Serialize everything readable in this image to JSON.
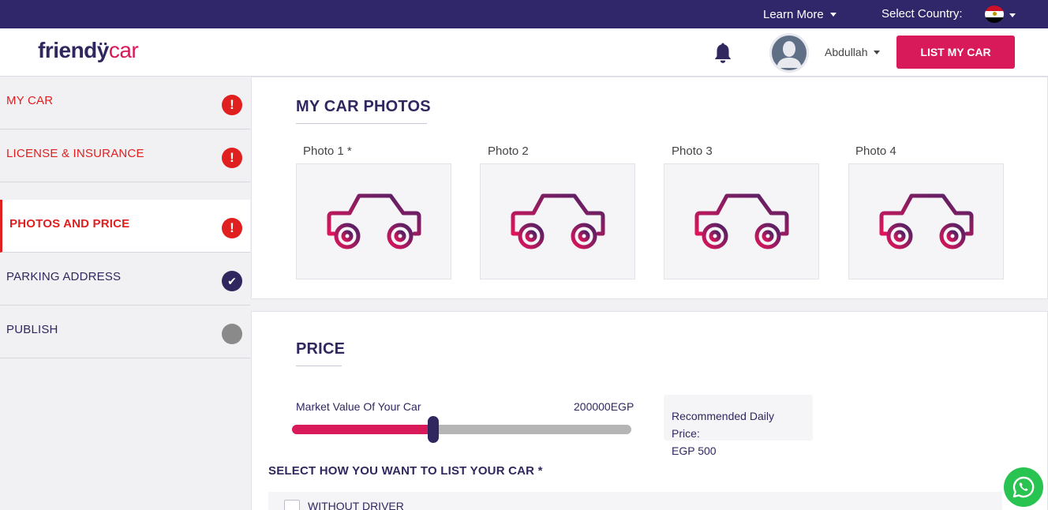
{
  "topbar": {
    "learn_more": "Learn More",
    "select_country": "Select Country:",
    "country_flag": "egypt-flag-icon"
  },
  "header": {
    "logo_part1": "friendÿ",
    "logo_part2": "car",
    "username": "Abdullah",
    "list_button": "LIST MY CAR"
  },
  "sidebar": {
    "items": [
      {
        "label": "MY CAR",
        "status": "error"
      },
      {
        "label": "LICENSE & INSURANCE",
        "status": "error"
      },
      {
        "label": "PHOTOS AND PRICE",
        "status": "error",
        "active": true
      },
      {
        "label": "PARKING ADDRESS",
        "status": "complete"
      },
      {
        "label": "PUBLISH",
        "status": "pending"
      }
    ],
    "error_glyph": "!",
    "check_glyph": "✔"
  },
  "photos": {
    "title": "MY CAR PHOTOS",
    "slots": [
      {
        "label": "Photo 1 *"
      },
      {
        "label": "Photo 2"
      },
      {
        "label": "Photo 3"
      },
      {
        "label": "Photo 4"
      }
    ]
  },
  "price": {
    "title": "PRICE",
    "market_value_label": "Market Value Of Your Car",
    "market_value": "200000EGP",
    "slider_fraction": 0.41,
    "recommended_label": "Recommended Daily Price:",
    "recommended_value": "EGP 500",
    "select_title": "SELECT HOW YOU WANT TO LIST YOUR CAR *",
    "option_without_driver": "WITHOUT DRIVER"
  },
  "colors": {
    "navy": "#2f2769",
    "accent": "#d8195a",
    "error": "#e01f1f",
    "pending": "#8a8a8a",
    "whatsapp": "#28c350"
  }
}
